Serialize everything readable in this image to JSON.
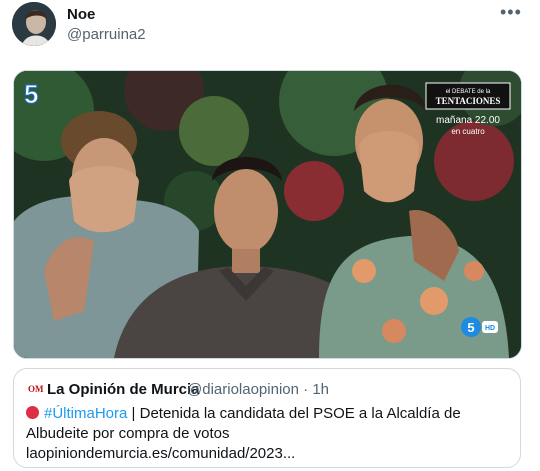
{
  "author": {
    "display_name": "Noe",
    "handle": "@parruina2"
  },
  "more_icon": "more-dots-icon",
  "media": {
    "channel_logo": "5",
    "overlay_line1": "el DEBATE de la",
    "overlay_line2": "TENTACIONES",
    "overlay_line3": "mañana 22.00",
    "overlay_line4": "en cuatro",
    "corner_logo": "5",
    "corner_badge": "HD"
  },
  "quote": {
    "logo_text": "OM",
    "name": "La Opinión de Murcia",
    "handle": "@diariolaopinion",
    "separator": "·",
    "time": "1h",
    "hashtag": "#ÚltimaHora",
    "bar": "|",
    "text": "Detenida la candidata del PSOE a la Alcaldía de Albudeite por compra de votos",
    "link": "laopiniondemurcia.es/comunidad/2023..."
  },
  "colors": {
    "link_blue": "#1d9bf0",
    "muted": "#536471",
    "border": "#cfd9de"
  }
}
